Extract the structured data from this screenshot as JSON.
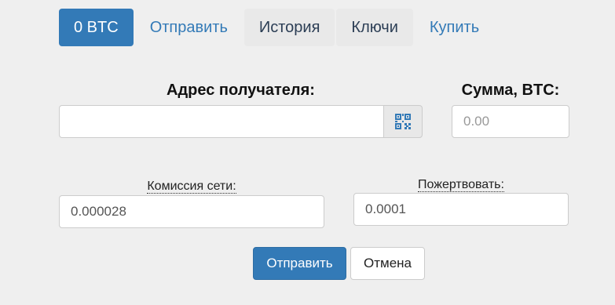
{
  "nav": {
    "balance": "0 BTC",
    "send": "Отправить",
    "history": "История",
    "keys": "Ключи",
    "buy": "Купить"
  },
  "form": {
    "recipient_label": "Адрес получателя:",
    "recipient_value": "",
    "recipient_placeholder": "",
    "qr_icon": "qr-code-icon",
    "amount_label": "Сумма, BTC:",
    "amount_value": "",
    "amount_placeholder": "0.00",
    "fee_label": "Комиссия сети:",
    "fee_value": "0.000028",
    "donate_label": "Пожертвовать:",
    "donate_value": "0.0001",
    "submit_label": "Отправить",
    "cancel_label": "Отмена"
  },
  "colors": {
    "primary": "#337ab7",
    "background": "#efefef"
  }
}
